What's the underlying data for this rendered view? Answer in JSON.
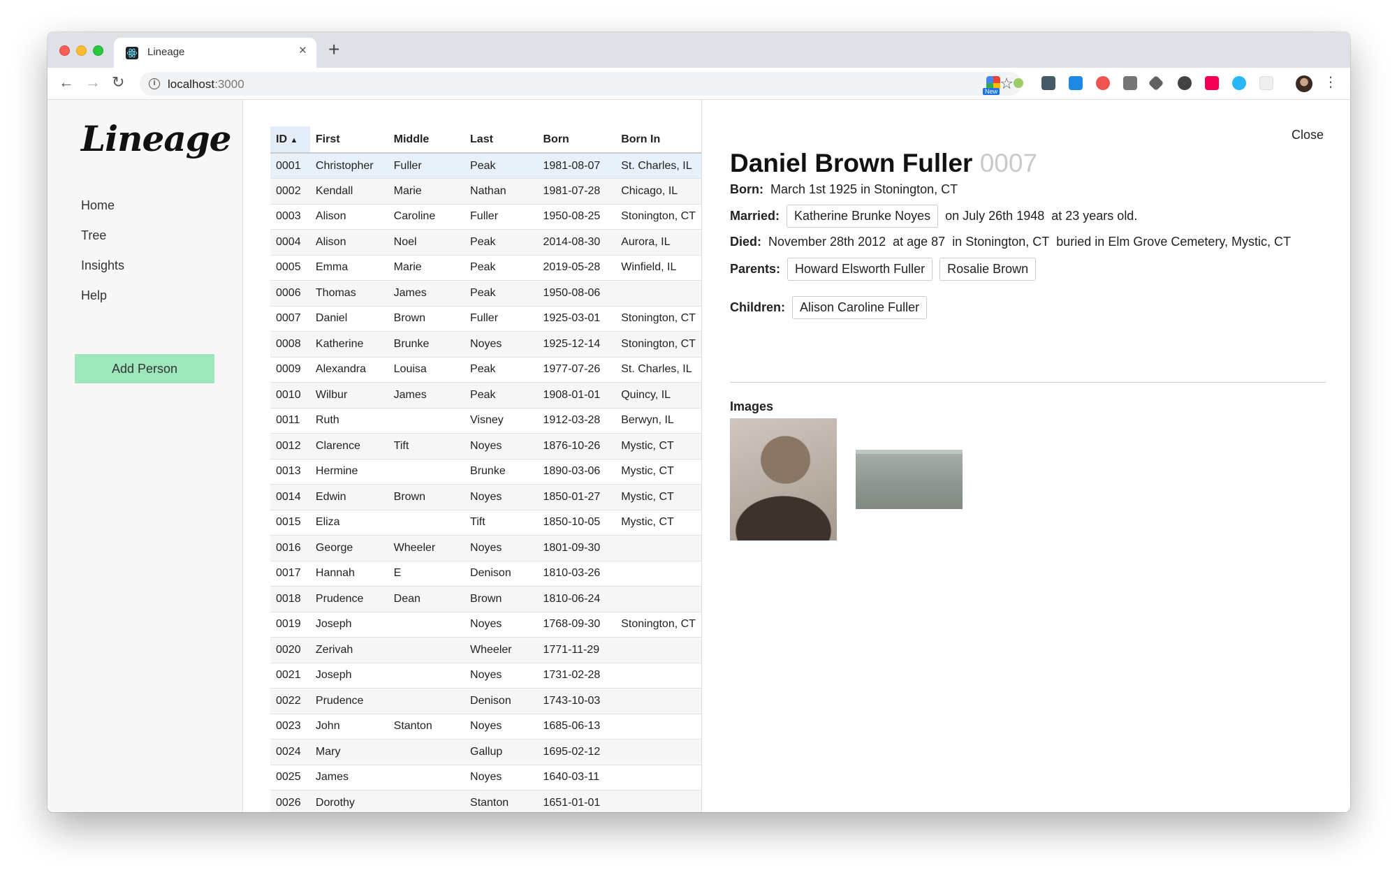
{
  "browser": {
    "tab_title": "Lineage",
    "tab_close": "×",
    "new_tab": "+",
    "url_host": "localhost",
    "url_port": ":3000",
    "ext_badge": "New"
  },
  "sidebar": {
    "logo": "Lineage",
    "nav": [
      "Home",
      "Tree",
      "Insights",
      "Help"
    ],
    "add_person": "Add Person"
  },
  "table": {
    "headers": [
      "ID",
      "First",
      "Middle",
      "Last",
      "Born",
      "Born In"
    ],
    "sort_indicator": "▲",
    "rows": [
      [
        "0001",
        "Christopher",
        "Fuller",
        "Peak",
        "1981-08-07",
        "St. Charles, IL"
      ],
      [
        "0002",
        "Kendall",
        "Marie",
        "Nathan",
        "1981-07-28",
        "Chicago, IL"
      ],
      [
        "0003",
        "Alison",
        "Caroline",
        "Fuller",
        "1950-08-25",
        "Stonington, CT"
      ],
      [
        "0004",
        "Alison",
        "Noel",
        "Peak",
        "2014-08-30",
        "Aurora, IL"
      ],
      [
        "0005",
        "Emma",
        "Marie",
        "Peak",
        "2019-05-28",
        "Winfield, IL"
      ],
      [
        "0006",
        "Thomas",
        "James",
        "Peak",
        "1950-08-06",
        ""
      ],
      [
        "0007",
        "Daniel",
        "Brown",
        "Fuller",
        "1925-03-01",
        "Stonington, CT"
      ],
      [
        "0008",
        "Katherine",
        "Brunke",
        "Noyes",
        "1925-12-14",
        "Stonington, CT"
      ],
      [
        "0009",
        "Alexandra",
        "Louisa",
        "Peak",
        "1977-07-26",
        "St. Charles, IL"
      ],
      [
        "0010",
        "Wilbur",
        "James",
        "Peak",
        "1908-01-01",
        "Quincy, IL"
      ],
      [
        "0011",
        "Ruth",
        "",
        "Visney",
        "1912-03-28",
        "Berwyn, IL"
      ],
      [
        "0012",
        "Clarence",
        "Tift",
        "Noyes",
        "1876-10-26",
        "Mystic, CT"
      ],
      [
        "0013",
        "Hermine",
        "",
        "Brunke",
        "1890-03-06",
        "Mystic, CT"
      ],
      [
        "0014",
        "Edwin",
        "Brown",
        "Noyes",
        "1850-01-27",
        "Mystic, CT"
      ],
      [
        "0015",
        "Eliza",
        "",
        "Tift",
        "1850-10-05",
        "Mystic, CT"
      ],
      [
        "0016",
        "George",
        "Wheeler",
        "Noyes",
        "1801-09-30",
        ""
      ],
      [
        "0017",
        "Hannah",
        "E",
        "Denison",
        "1810-03-26",
        ""
      ],
      [
        "0018",
        "Prudence",
        "Dean",
        "Brown",
        "1810-06-24",
        ""
      ],
      [
        "0019",
        "Joseph",
        "",
        "Noyes",
        "1768-09-30",
        "Stonington, CT"
      ],
      [
        "0020",
        "Zerivah",
        "",
        "Wheeler",
        "1771-11-29",
        ""
      ],
      [
        "0021",
        "Joseph",
        "",
        "Noyes",
        "1731-02-28",
        ""
      ],
      [
        "0022",
        "Prudence",
        "",
        "Denison",
        "1743-10-03",
        ""
      ],
      [
        "0023",
        "John",
        "Stanton",
        "Noyes",
        "1685-06-13",
        ""
      ],
      [
        "0024",
        "Mary",
        "",
        "Gallup",
        "1695-02-12",
        ""
      ],
      [
        "0025",
        "James",
        "",
        "Noyes",
        "1640-03-11",
        ""
      ],
      [
        "0026",
        "Dorothy",
        "",
        "Stanton",
        "1651-01-01",
        ""
      ]
    ]
  },
  "detail": {
    "close": "Close",
    "name": "Daniel Brown Fuller",
    "id": "0007",
    "born_label": "Born:",
    "born_text": "March 1st 1925 in Stonington, CT",
    "married_label": "Married:",
    "spouse": "Katherine Brunke Noyes",
    "married_date": "on July 26th 1948",
    "married_age": "at 23 years old.",
    "died_label": "Died:",
    "died_date": "November 28th 2012",
    "died_age": "at age 87",
    "died_place": "in Stonington, CT",
    "buried": "buried in Elm Grove Cemetery, Mystic, CT",
    "parents_label": "Parents:",
    "parents": [
      "Howard Elsworth Fuller",
      "Rosalie Brown"
    ],
    "children_label": "Children:",
    "children": [
      "Alison Caroline Fuller"
    ],
    "images_label": "Images"
  },
  "colors": {
    "add_person_bg": "#9ee6bc",
    "selected_row": "#e8f0fa",
    "id_muted": "#c9c9c9"
  }
}
